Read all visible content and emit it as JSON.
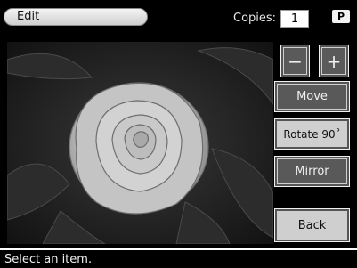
{
  "header": {
    "title": "Edit",
    "copies_label": "Copies:",
    "copies_value": "1",
    "badge": "P"
  },
  "sidebar": {
    "minus_label": "−",
    "plus_label": "+",
    "move_label": "Move",
    "rotate_label": "Rotate 90˚",
    "mirror_label": "Mirror",
    "back_label": "Back"
  },
  "status": {
    "message": "Select an item."
  },
  "photo": {
    "subject": "rose-flower"
  }
}
